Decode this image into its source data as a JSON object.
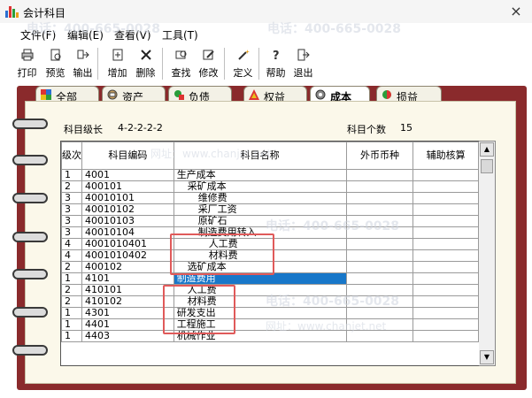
{
  "window": {
    "title": "会计科目",
    "close": "×"
  },
  "menu": [
    "文件(F)",
    "编辑(E)",
    "查看(V)",
    "工具(T)"
  ],
  "toolbar": [
    "打印",
    "预览",
    "输出",
    "增加",
    "删除",
    "查找",
    "修改",
    "定义",
    "帮助",
    "退出"
  ],
  "tabs": [
    "全部",
    "资产",
    "负债",
    "权益",
    "成本",
    "损益"
  ],
  "active_tab": "成本",
  "info": {
    "level_label": "科目级长",
    "level_value": "4-2-2-2-2",
    "count_label": "科目个数",
    "count_value": "15"
  },
  "grid": {
    "headers": [
      "级次",
      "科目编码",
      "科目名称",
      "外币币种",
      "辅助核算"
    ],
    "rows": [
      {
        "level": "1",
        "code": "4001",
        "name": "生产成本"
      },
      {
        "level": "2",
        "code": "400101",
        "name": "采矿成本"
      },
      {
        "level": "3",
        "code": "40010101",
        "name": "维修费"
      },
      {
        "level": "3",
        "code": "40010102",
        "name": "采厂工资"
      },
      {
        "level": "3",
        "code": "40010103",
        "name": "原矿石"
      },
      {
        "level": "3",
        "code": "40010104",
        "name": "制造费用转入"
      },
      {
        "level": "4",
        "code": "4001010401",
        "name": "人工费"
      },
      {
        "level": "4",
        "code": "4001010402",
        "name": "材料费"
      },
      {
        "level": "2",
        "code": "400102",
        "name": "选矿成本"
      },
      {
        "level": "1",
        "code": "4101",
        "name": "制造费用"
      },
      {
        "level": "2",
        "code": "410101",
        "name": "人工费"
      },
      {
        "level": "2",
        "code": "410102",
        "name": "材料费"
      },
      {
        "level": "1",
        "code": "4301",
        "name": "研发支出"
      },
      {
        "level": "1",
        "code": "4401",
        "name": "工程施工"
      },
      {
        "level": "1",
        "code": "4403",
        "name": "机械作业"
      }
    ],
    "selected_row": 9
  },
  "watermark": {
    "phone": "电话：400-665-0028",
    "site": "网址：www.chanjet.net"
  },
  "colors": {
    "frame": "#8a2a2c",
    "selection": "#1877c9",
    "highlight": "#e05a5a"
  }
}
